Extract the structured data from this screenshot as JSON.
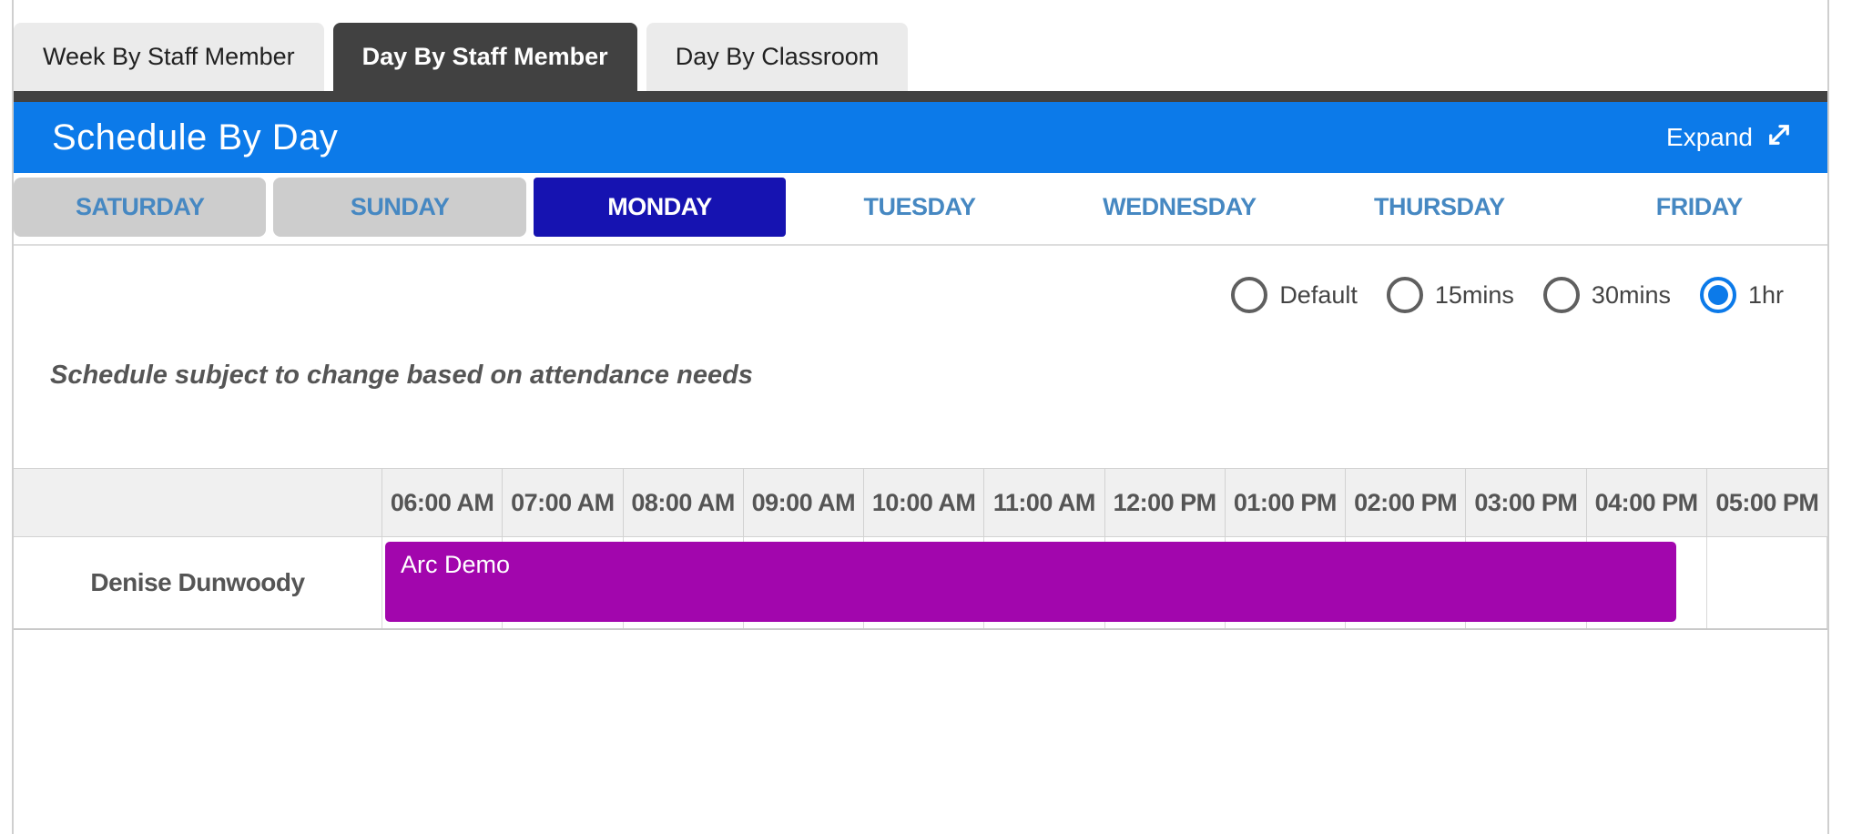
{
  "top_tabs": [
    {
      "label": "Week By Staff Member",
      "active": false
    },
    {
      "label": "Day By Staff Member",
      "active": true
    },
    {
      "label": "Day By Classroom",
      "active": false
    }
  ],
  "header": {
    "title": "Schedule By Day",
    "expand_label": "Expand",
    "expand_icon": "expand-diagonal-arrows"
  },
  "day_tabs": [
    {
      "label": "SATURDAY",
      "state": "closed"
    },
    {
      "label": "SUNDAY",
      "state": "closed"
    },
    {
      "label": "MONDAY",
      "state": "active"
    },
    {
      "label": "TUESDAY",
      "state": "normal"
    },
    {
      "label": "WEDNESDAY",
      "state": "normal"
    },
    {
      "label": "THURSDAY",
      "state": "normal"
    },
    {
      "label": "FRIDAY",
      "state": "normal"
    }
  ],
  "interval_options": [
    {
      "label": "Default",
      "selected": false
    },
    {
      "label": "15mins",
      "selected": false
    },
    {
      "label": "30mins",
      "selected": false
    },
    {
      "label": "1hr",
      "selected": true
    }
  ],
  "note": "Schedule subject to change based on attendance needs",
  "schedule": {
    "time_columns": [
      "06:00 AM",
      "07:00 AM",
      "08:00 AM",
      "09:00 AM",
      "10:00 AM",
      "11:00 AM",
      "12:00 PM",
      "01:00 PM",
      "02:00 PM",
      "03:00 PM",
      "04:00 PM",
      "05:00 PM"
    ],
    "rows": [
      {
        "staff": "Denise Dunwoody",
        "events": [
          {
            "label": "Arc Demo",
            "start_col": 0,
            "span_cols": 10.75,
            "color": "#a206ad"
          }
        ]
      }
    ]
  },
  "colors": {
    "accent_blue": "#0c7ae9",
    "active_day_blue": "#1613b1",
    "day_text_blue": "#4688c2",
    "dark_tab": "#414141",
    "event_purple": "#a206ad"
  }
}
